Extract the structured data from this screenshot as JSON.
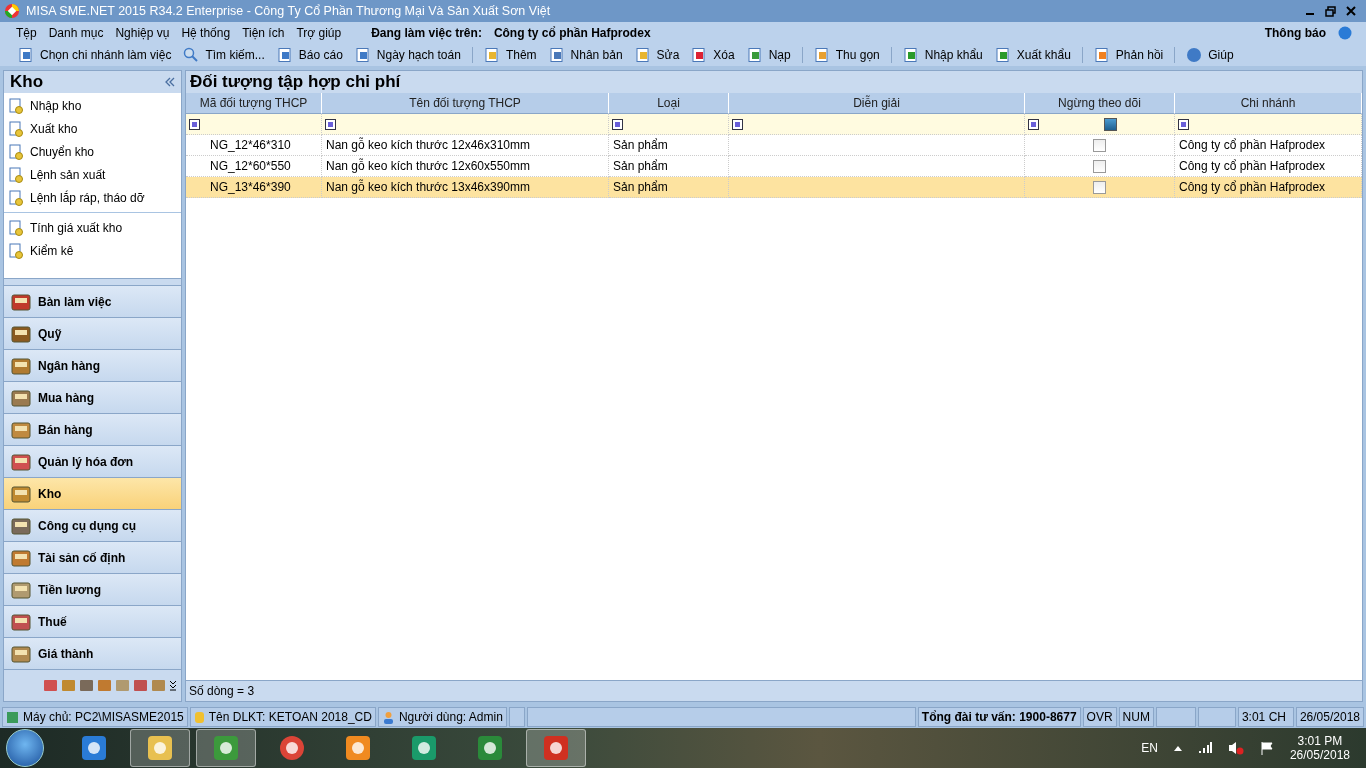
{
  "window": {
    "title": "MISA SME.NET 2015 R34.2 Enterprise - Công Ty Cổ Phần Thương Mại Và Sản Xuất Sơn Việt"
  },
  "menu": [
    "Tệp",
    "Danh mục",
    "Nghiệp vụ",
    "Hệ thống",
    "Tiện ích",
    "Trợ giúp"
  ],
  "workspace": {
    "label": "Đang làm việc trên:",
    "company": "Công ty cổ phần Hafprodex"
  },
  "notification": "Thông báo",
  "toolbar": [
    [
      "Chọn chi nhánh làm việc",
      "Tìm kiếm...",
      "Báo cáo",
      "Ngày hạch toán"
    ],
    [
      "Thêm",
      "Nhân bản",
      "Sửa",
      "Xóa",
      "Nạp"
    ],
    [
      "Thu gọn"
    ],
    [
      "Nhập khẩu",
      "Xuất khẩu"
    ],
    [
      "Phản hồi"
    ],
    [
      "Giúp"
    ]
  ],
  "sidebar": {
    "title": "Kho",
    "tasks": [
      [
        "Nhập kho",
        "Xuất kho",
        "Chuyển kho",
        "Lệnh sản xuất",
        "Lệnh lắp ráp, tháo dỡ"
      ],
      [
        "Tính giá xuất kho",
        "Kiểm kê"
      ]
    ],
    "modules": [
      {
        "label": "Bàn làm việc",
        "selected": false
      },
      {
        "label": "Quỹ",
        "selected": false
      },
      {
        "label": "Ngân hàng",
        "selected": false
      },
      {
        "label": "Mua hàng",
        "selected": false
      },
      {
        "label": "Bán hàng",
        "selected": false
      },
      {
        "label": "Quản lý hóa đơn",
        "selected": false
      },
      {
        "label": "Kho",
        "selected": true
      },
      {
        "label": "Công cụ dụng cụ",
        "selected": false
      },
      {
        "label": "Tài sản cố định",
        "selected": false
      },
      {
        "label": "Tiền lương",
        "selected": false
      },
      {
        "label": "Thuế",
        "selected": false
      },
      {
        "label": "Giá thành",
        "selected": false
      }
    ]
  },
  "content": {
    "title": "Đối tượng tập hợp chi phí",
    "table": {
      "columns": [
        "Mã đối tượng THCP",
        "Tên đối tượng THCP",
        "Loại",
        "Diễn giải",
        "Ngừng theo dõi",
        "Chi nhánh"
      ],
      "inactive_filter": {
        "indeterminate": true
      },
      "rows": [
        {
          "code": "NG_12*46*310",
          "name": "Nan gỗ keo kích thước 12x46x310mm",
          "type": "Sản phẩm",
          "inactive": false,
          "branch": "Công ty cổ phần Hafprodex",
          "selected": false
        },
        {
          "code": "NG_12*60*550",
          "name": "Nan gỗ keo kích thước 12x60x550mm",
          "type": "Sản phẩm",
          "inactive": false,
          "branch": "Công ty cổ phần Hafprodex",
          "selected": false
        },
        {
          "code": "NG_13*46*390",
          "name": "Nan gỗ keo kích thước 13x46x390mm",
          "type": "Sản phẩm",
          "inactive": false,
          "branch": "Công ty cổ phần Hafprodex",
          "selected": true
        }
      ]
    },
    "row_count": "Số dòng = 3"
  },
  "status_bar": {
    "server": "Máy chủ: PC2\\MISASME2015",
    "database": "Tên DLKT: KETOAN 2018_CD",
    "user": "Người dùng: Admin",
    "hotline": "Tổng đài tư vấn: 1900-8677",
    "ovr": "OVR",
    "num": "NUM",
    "time": "3:01 CH",
    "date": "26/05/2018"
  },
  "taskbar": {
    "apps": [
      {
        "selected": false
      },
      {
        "selected": true
      },
      {
        "selected": true
      },
      {
        "selected": false
      },
      {
        "selected": false
      },
      {
        "selected": false
      },
      {
        "selected": false
      },
      {
        "selected": true
      }
    ],
    "language": "EN",
    "clock_time": "3:01 PM",
    "clock_date": "26/05/2018"
  }
}
